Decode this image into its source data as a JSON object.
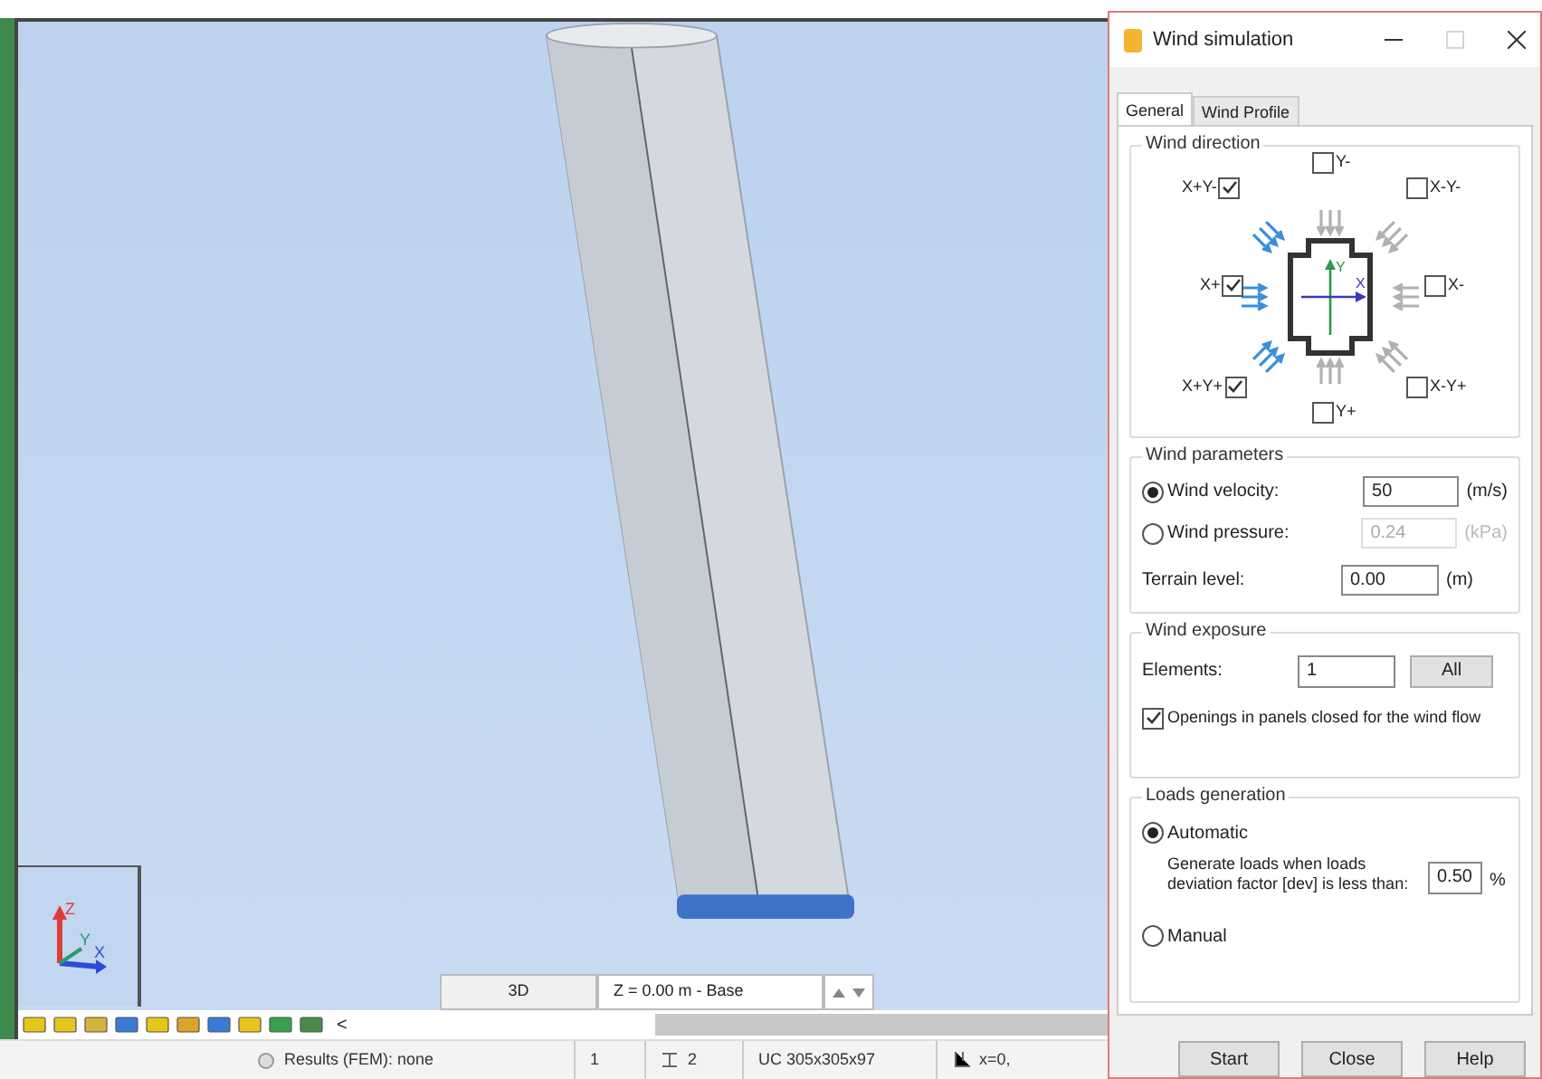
{
  "viewport": {
    "tabs": [
      {
        "label": "3D",
        "selected": true
      },
      {
        "label": "Z = 0.00 m - Base",
        "selected": false
      }
    ],
    "axes": [
      "Z",
      "Y",
      "X"
    ],
    "toolbar_more": "<"
  },
  "status_bar": {
    "results": "Results (FEM): none",
    "cells": [
      {
        "kind": "plain",
        "text": "1"
      },
      {
        "kind": "icon",
        "text": "2"
      },
      {
        "kind": "plain",
        "text": "UC 305x305x97"
      },
      {
        "kind": "coord",
        "text": "x=0,"
      }
    ]
  },
  "dialog": {
    "title": "Wind simulation",
    "tabs": [
      {
        "label": "General",
        "selected": true
      },
      {
        "label": "Wind Profile",
        "selected": false
      }
    ],
    "wind_direction": {
      "title": "Wind direction",
      "directions": [
        {
          "label": "X+Y-",
          "checked": true
        },
        {
          "label": "Y-",
          "checked": false
        },
        {
          "label": "X-Y-",
          "checked": false
        },
        {
          "label": "X+",
          "checked": true
        },
        {
          "label": "X-",
          "checked": false
        },
        {
          "label": "X+Y+",
          "checked": true
        },
        {
          "label": "Y+",
          "checked": false
        },
        {
          "label": "X-Y+",
          "checked": false
        }
      ],
      "axis_labels": [
        "Y",
        "X"
      ]
    },
    "wind_parameters": {
      "title": "Wind parameters",
      "rows": [
        {
          "kind": "radio",
          "label": "Wind velocity:",
          "selected": true,
          "value": "50",
          "unit": "(m/s)",
          "disabled": false
        },
        {
          "kind": "radio",
          "label": "Wind pressure:",
          "selected": false,
          "value": "0.24",
          "unit": "(kPa)",
          "disabled": true
        },
        {
          "kind": "plain",
          "label": "Terrain level:",
          "value": "0.00",
          "unit": "(m)",
          "disabled": false
        }
      ]
    },
    "wind_exposure": {
      "title": "Wind exposure",
      "elements_label": "Elements:",
      "elements_value": "1",
      "all_button": "All",
      "openings": {
        "label": "Openings in panels closed for the wind flow",
        "checked": true
      }
    },
    "loads_generation": {
      "title": "Loads generation",
      "options": [
        {
          "label": "Automatic",
          "selected": true
        },
        {
          "label": "Manual",
          "selected": false
        }
      ],
      "note": "Generate loads when loads deviation factor [dev] is less than:",
      "value": "0.50",
      "unit": "%"
    },
    "buttons": [
      "Start",
      "Close",
      "Help"
    ]
  }
}
